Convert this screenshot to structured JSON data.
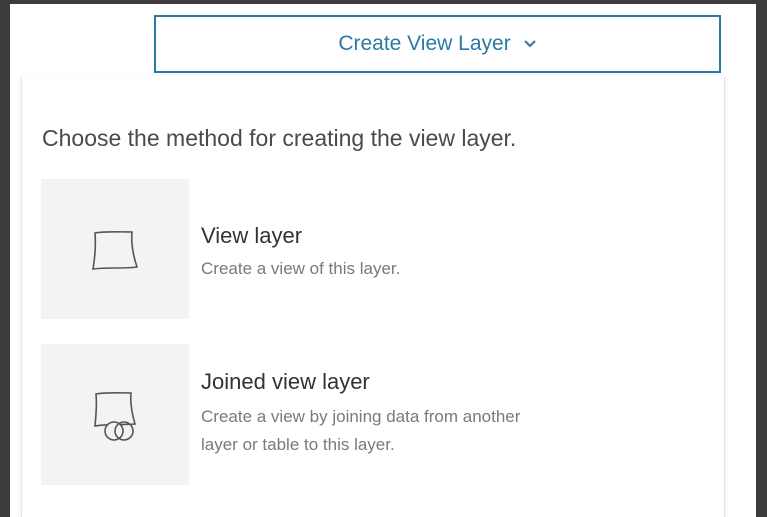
{
  "dropdown": {
    "label": "Create View Layer",
    "icon": "chevron-down-icon"
  },
  "menu": {
    "prompt": "Choose the method for creating the view layer.",
    "options": [
      {
        "title": "View layer",
        "description": "Create a view of this layer.",
        "icon": "layer-outline-icon"
      },
      {
        "title": "Joined view layer",
        "description_lines": [
          "Create a view by joining data from another",
          "layer or table to this layer."
        ],
        "icon": "joined-layer-icon"
      }
    ]
  },
  "colors": {
    "accent": "#2b79a6",
    "thumb_bg": "#f3f3f3",
    "background": "#3c3c3c"
  }
}
